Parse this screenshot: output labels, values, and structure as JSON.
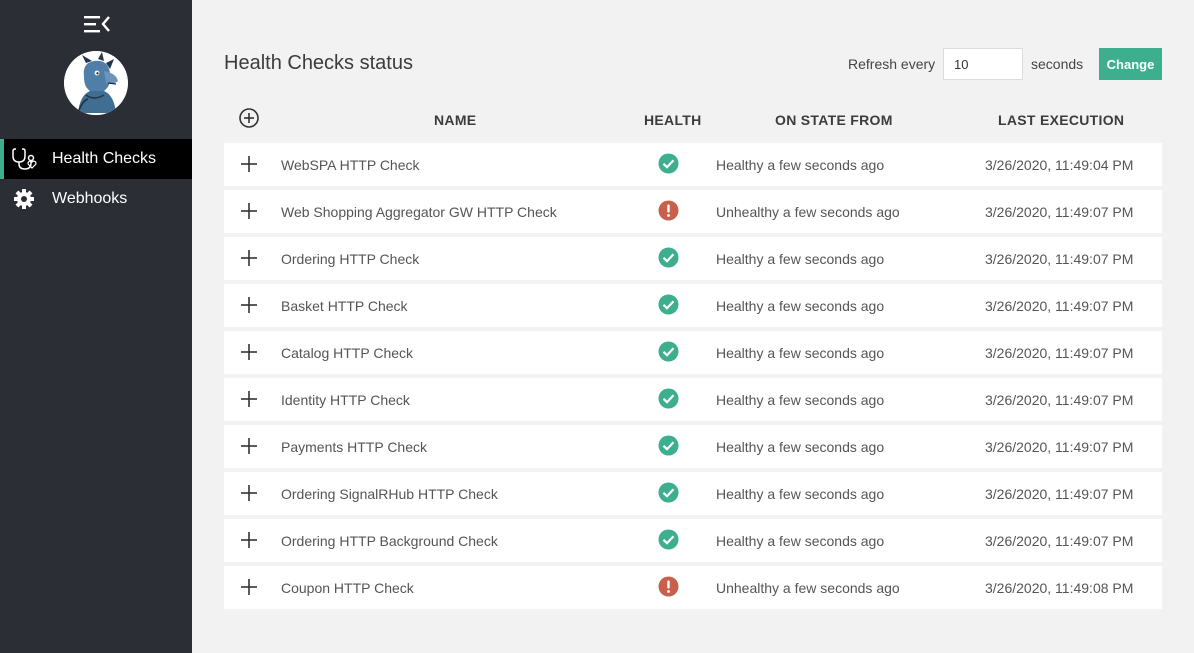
{
  "sidebar": {
    "menu_icon": "collapse-menu-icon",
    "avatar_icon": "mascot-avatar",
    "items": [
      {
        "label": "Health Checks",
        "icon": "stethoscope-icon",
        "active": true
      },
      {
        "label": "Webhooks",
        "icon": "gear-icon",
        "active": false
      }
    ]
  },
  "header": {
    "title": "Health Checks status",
    "refresh_label": "Refresh every",
    "refresh_value": "10",
    "seconds_label": "seconds",
    "change_label": "Change"
  },
  "table": {
    "columns": [
      "NAME",
      "HEALTH",
      "ON STATE FROM",
      "LAST EXECUTION"
    ],
    "rows": [
      {
        "name": "WebSPA HTTP Check",
        "health": "healthy",
        "on_state": "Healthy a few seconds ago",
        "last_execution": "3/26/2020, 11:49:04 PM"
      },
      {
        "name": "Web Shopping Aggregator GW HTTP Check",
        "health": "unhealthy",
        "on_state": "Unhealthy a few seconds ago",
        "last_execution": "3/26/2020, 11:49:07 PM"
      },
      {
        "name": "Ordering HTTP Check",
        "health": "healthy",
        "on_state": "Healthy a few seconds ago",
        "last_execution": "3/26/2020, 11:49:07 PM"
      },
      {
        "name": "Basket HTTP Check",
        "health": "healthy",
        "on_state": "Healthy a few seconds ago",
        "last_execution": "3/26/2020, 11:49:07 PM"
      },
      {
        "name": "Catalog HTTP Check",
        "health": "healthy",
        "on_state": "Healthy a few seconds ago",
        "last_execution": "3/26/2020, 11:49:07 PM"
      },
      {
        "name": "Identity HTTP Check",
        "health": "healthy",
        "on_state": "Healthy a few seconds ago",
        "last_execution": "3/26/2020, 11:49:07 PM"
      },
      {
        "name": "Payments HTTP Check",
        "health": "healthy",
        "on_state": "Healthy a few seconds ago",
        "last_execution": "3/26/2020, 11:49:07 PM"
      },
      {
        "name": "Ordering SignalRHub HTTP Check",
        "health": "healthy",
        "on_state": "Healthy a few seconds ago",
        "last_execution": "3/26/2020, 11:49:07 PM"
      },
      {
        "name": "Ordering HTTP Background Check",
        "health": "healthy",
        "on_state": "Healthy a few seconds ago",
        "last_execution": "3/26/2020, 11:49:07 PM"
      },
      {
        "name": "Coupon HTTP Check",
        "health": "unhealthy",
        "on_state": "Unhealthy a few seconds ago",
        "last_execution": "3/26/2020, 11:49:08 PM"
      }
    ]
  },
  "colors": {
    "sidebar_bg": "#2c2e36",
    "accent": "#3dae8e",
    "healthy": "#3dae8e",
    "unhealthy": "#c8604b"
  }
}
